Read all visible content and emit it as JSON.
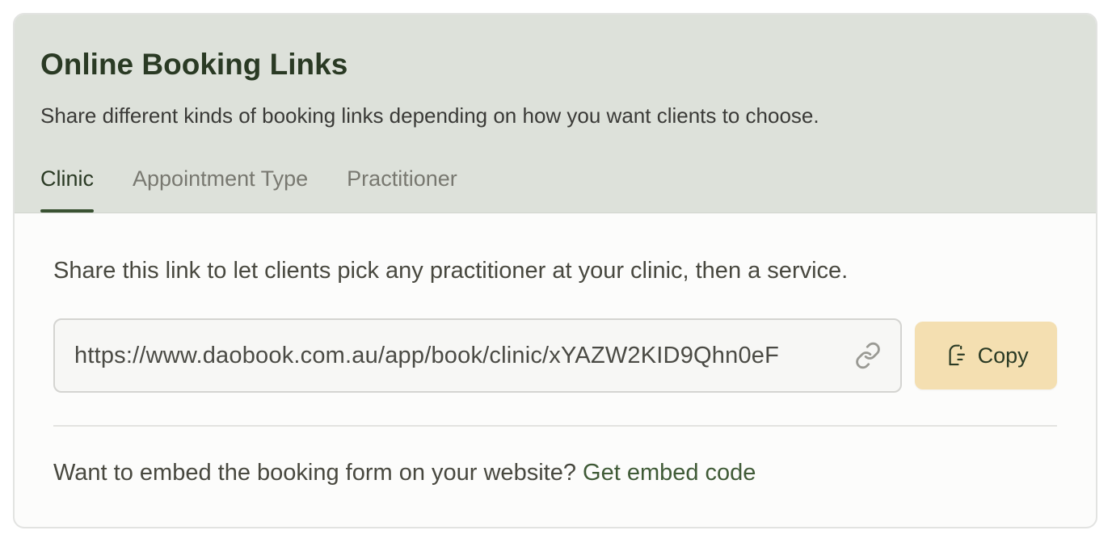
{
  "header": {
    "title": "Online Booking Links",
    "subtitle": "Share different kinds of booking links depending on how you want clients to choose."
  },
  "tabs": [
    {
      "label": "Clinic",
      "active": true
    },
    {
      "label": "Appointment Type",
      "active": false
    },
    {
      "label": "Practitioner",
      "active": false
    }
  ],
  "main": {
    "description": "Share this link to let clients pick any practitioner at your clinic, then a service.",
    "url": "https://www.daobook.com.au/app/book/clinic/xYAZW2KID9Qhn0eF",
    "copy_label": "Copy",
    "embed_prompt": "Want to embed the booking form on your website?",
    "embed_link": "Get embed code"
  },
  "icons": {
    "link": "link-icon",
    "copy": "copy-icon"
  },
  "colors": {
    "header_bg": "#dde1da",
    "accent": "#3a5232",
    "copy_button_bg": "#f4dfb1"
  }
}
